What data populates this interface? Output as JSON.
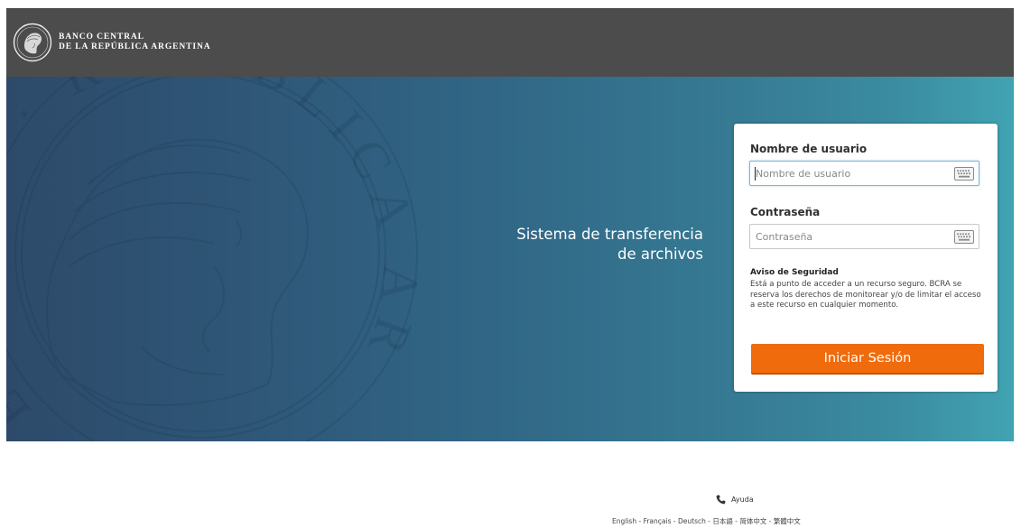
{
  "header": {
    "brand_line1": "BANCO CENTRAL",
    "brand_line2": "DE LA REPÚBLICA ARGENTINA",
    "logo_icon": "bcra-medallion-icon",
    "background": "#4c4c4c"
  },
  "hero": {
    "title_line1": "Sistema de transferencia",
    "title_line2": "de archivos",
    "gradient_start": "#2d4a6a",
    "gradient_end": "#41a3b2",
    "seal_text": "ENTRAL · REPÚBLICA ARGENTINA"
  },
  "login": {
    "username_label": "Nombre de usuario",
    "username_placeholder": "Nombre de usuario",
    "username_value": "",
    "password_label": "Contraseña",
    "password_placeholder": "Contraseña",
    "password_value": "",
    "keyboard_icon": "virtual-keyboard-icon",
    "notice_title": "Aviso de Seguridad",
    "notice_text": "Está a punto de acceder a un recurso seguro. BCRA se reserva los derechos de monitorear y/o de limitar el acceso a este recurso en cualquier momento.",
    "submit_label": "Iniciar Sesión",
    "submit_color": "#f06b0b"
  },
  "footer": {
    "help_label": "Ayuda",
    "help_icon": "phone-icon",
    "languages": [
      "English",
      "Français",
      "Deutsch",
      "日本語",
      "简体中文",
      "繁體中文"
    ],
    "separator": " - "
  }
}
